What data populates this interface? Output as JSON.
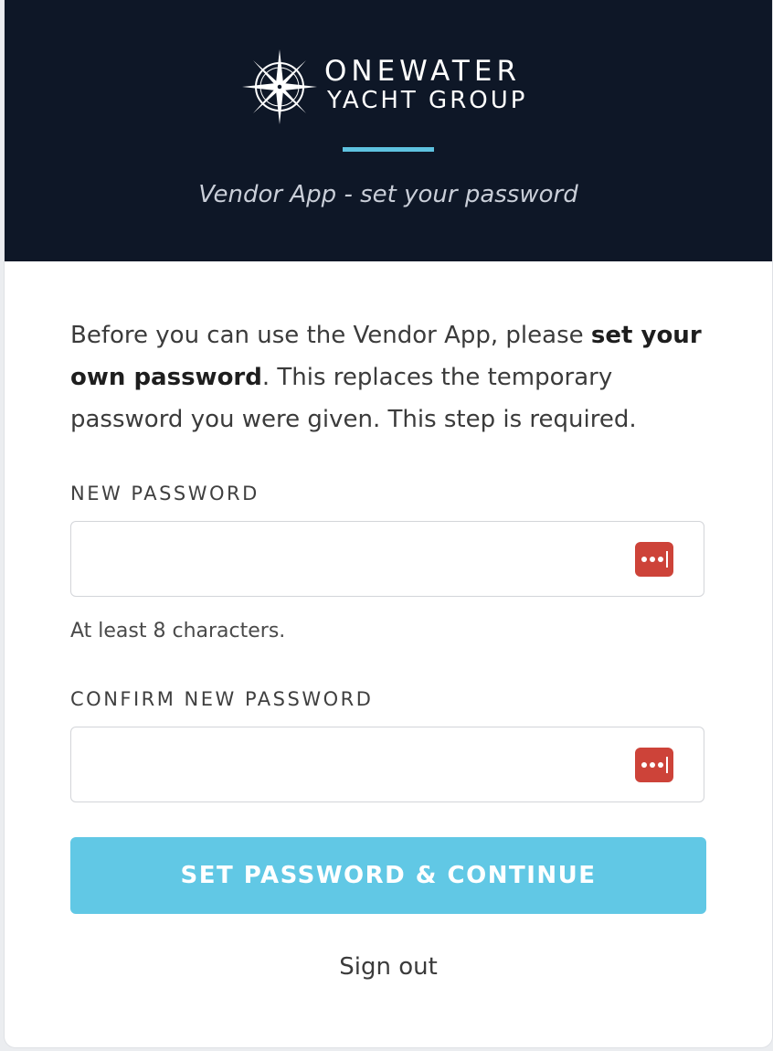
{
  "brand": {
    "line1": "ONEWATER",
    "line2": "YACHT GROUP",
    "logo_icon": "compass-rose-icon"
  },
  "header": {
    "subtitle": "Vendor App - set your password",
    "background": "#0e1727",
    "accent": "#5ec2e0"
  },
  "intro": {
    "part1": "Before you can use the Vendor App, please ",
    "bold": "set your own password",
    "part2": ". This replaces the temporary password you were given. This step is required."
  },
  "new_password": {
    "label": "NEW PASSWORD",
    "value": "",
    "hint": "At least 8 characters.",
    "manager_icon": "password-manager-icon"
  },
  "confirm_password": {
    "label": "CONFIRM NEW PASSWORD",
    "value": "",
    "manager_icon": "password-manager-icon"
  },
  "actions": {
    "submit_label": "SET PASSWORD & CONTINUE",
    "submit_color": "#61c8e5",
    "sign_out_label": "Sign out"
  }
}
